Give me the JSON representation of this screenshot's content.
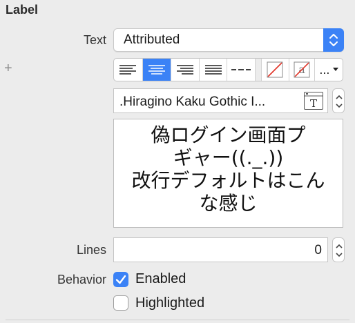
{
  "section": {
    "title": "Label"
  },
  "text_row": {
    "label": "Text",
    "value": "Attributed"
  },
  "alignment": {
    "options": [
      "left",
      "center",
      "right",
      "justified",
      "natural"
    ],
    "selected": "center",
    "more_label": "..."
  },
  "font": {
    "value": ".Hiragino Kaku Gothic I..."
  },
  "text_content": {
    "lines": [
      "偽ログイン画面プ",
      "ギャー((._.))",
      "改行デフォルトはこん",
      "な感じ"
    ]
  },
  "lines_row": {
    "label": "Lines",
    "value": "0"
  },
  "behavior": {
    "label": "Behavior",
    "enabled": {
      "label": "Enabled",
      "checked": true
    },
    "highlighted": {
      "label": "Highlighted",
      "checked": false
    }
  },
  "colors": {
    "accent": "#3b82f6"
  },
  "icons": [
    "plus-icon",
    "popup-chevrons-icon",
    "strike-color-icon",
    "text-color-icon",
    "font-panel-icon",
    "stepper-icon",
    "checkmark-icon"
  ]
}
